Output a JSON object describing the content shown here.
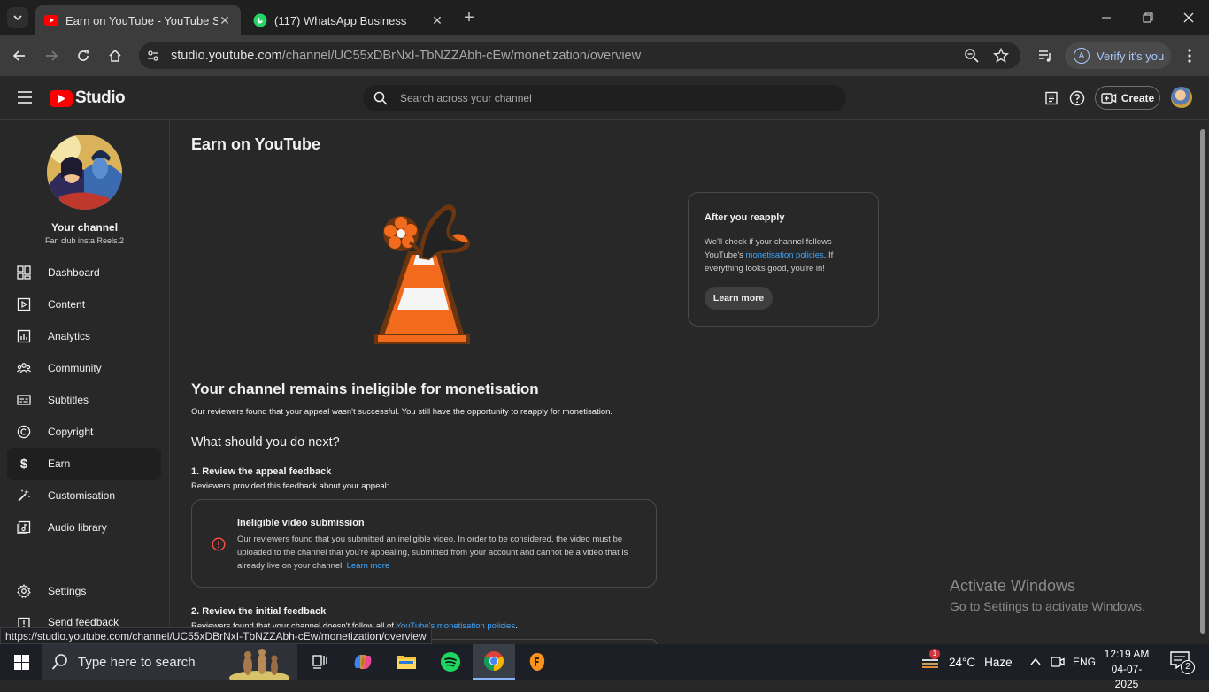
{
  "browser": {
    "tabs": [
      {
        "title": "Earn on YouTube - YouTube Stu",
        "active": true
      },
      {
        "title": "(117) WhatsApp Business",
        "active": false
      }
    ],
    "url_host": "studio.youtube.com",
    "url_path": "/channel/UC55xDBrNxI-TbNZZAbh-cEw/monetization/overview",
    "verify_label": "Verify it's you",
    "verify_avatar": "A",
    "status_url": "https://studio.youtube.com/channel/UC55xDBrNxI-TbNZZAbh-cEw/monetization/overview"
  },
  "header": {
    "logo_text": "Studio",
    "search_placeholder": "Search across your channel",
    "create_label": "Create"
  },
  "sidebar": {
    "channel_title": "Your channel",
    "channel_name": "Fan club insta Reels.2",
    "items": [
      {
        "label": "Dashboard",
        "icon": "dashboard-icon"
      },
      {
        "label": "Content",
        "icon": "content-icon"
      },
      {
        "label": "Analytics",
        "icon": "analytics-icon"
      },
      {
        "label": "Community",
        "icon": "community-icon"
      },
      {
        "label": "Subtitles",
        "icon": "subtitles-icon"
      },
      {
        "label": "Copyright",
        "icon": "copyright-icon"
      },
      {
        "label": "Earn",
        "icon": "dollar-icon",
        "active": true
      },
      {
        "label": "Customisation",
        "icon": "magic-wand-icon"
      },
      {
        "label": "Audio library",
        "icon": "audio-library-icon"
      }
    ],
    "settings_label": "Settings",
    "feedback_label": "Send feedback"
  },
  "main": {
    "page_title": "Earn on YouTube",
    "reapply_card": {
      "title": "After you reapply",
      "text_before": "We'll check if your channel follows YouTube's ",
      "link_text": "monetisation policies",
      "text_after": ". If everything looks good, you're in!",
      "button_label": "Learn more"
    },
    "status_title": "Your channel remains ineligible for monetisation",
    "status_text": "Our reviewers found that your appeal wasn't successful. You still have the opportunity to reapply for monetisation.",
    "next_title": "What should you do next?",
    "step1_title": "1. Review the appeal feedback",
    "step1_text": "Reviewers provided this feedback about your appeal:",
    "feedback_card": {
      "title": "Ineligible video submission",
      "text": "Our reviewers found that you submitted an ineligible video. In order to be considered, the video must be uploaded to the channel that you're appealing, submitted from your account and cannot be a video that is already live on your channel.",
      "link_text": "Learn more"
    },
    "step2_title": "2. Review the initial feedback",
    "step2_text_before": "Reviewers found that your channel doesn't follow all of ",
    "step2_link": "YouTube's monetisation policies",
    "step2_text_after": "."
  },
  "watermark": {
    "line1": "Activate Windows",
    "line2": "Go to Settings to activate Windows."
  },
  "taskbar": {
    "search_placeholder": "Type here to search",
    "weather_temp": "24°C",
    "weather_desc": "Haze",
    "weather_badge": "1",
    "language": "ENG",
    "time": "12:19 AM",
    "date": "04-07-2025",
    "notification_count": "2"
  },
  "colors": {
    "youtube_red": "#ff0000",
    "link_blue": "#3ea6ff",
    "cone_orange": "#f26a1b",
    "background": "#282828"
  }
}
